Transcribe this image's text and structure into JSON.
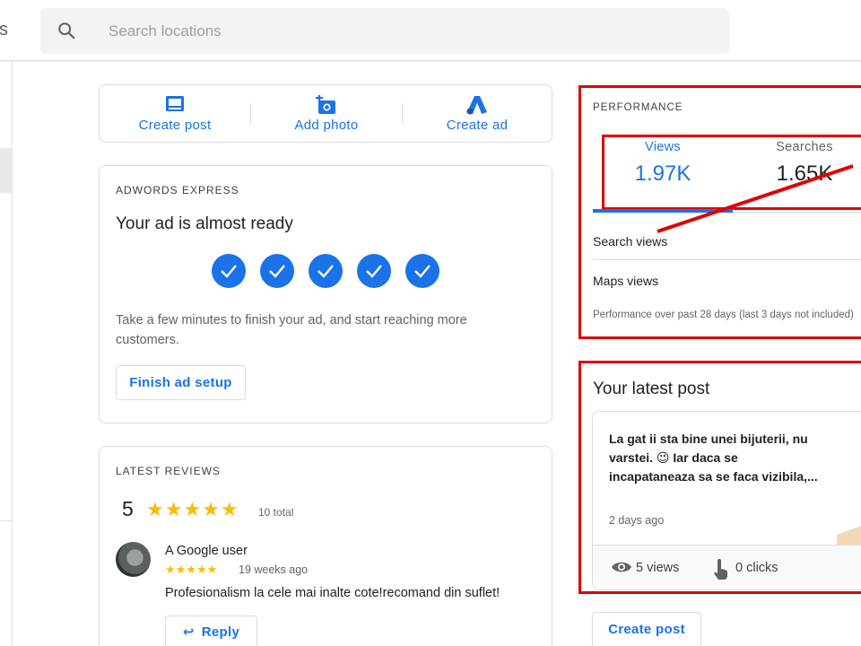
{
  "header": {
    "cut_title": "s",
    "search_placeholder": "Search locations"
  },
  "actions": [
    {
      "label": "Create post",
      "icon": "post-icon"
    },
    {
      "label": "Add photo",
      "icon": "add-photo-icon"
    },
    {
      "label": "Create ad",
      "icon": "google-ads-icon"
    }
  ],
  "adwords": {
    "overline": "ADWORDS EXPRESS",
    "title": "Your ad is almost ready",
    "steps_completed": 5,
    "description": "Take a few minutes to finish your ad, and start reaching more customers.",
    "button": "Finish ad setup"
  },
  "reviews": {
    "overline": "LATEST REVIEWS",
    "rating": "5",
    "stars": 5,
    "total": "10 total",
    "latest": {
      "author": "A Google user",
      "stars": 5,
      "when": "19 weeks ago",
      "text": "Profesionalism la cele mai inalte cote!recomand din suflet!",
      "reply_label": "Reply"
    }
  },
  "performance": {
    "overline": "PERFORMANCE",
    "tabs": [
      {
        "label": "Views",
        "value": "1.97K",
        "active": true
      },
      {
        "label": "Searches",
        "value": "1.65K",
        "active": false
      }
    ],
    "rows": [
      "Search views",
      "Maps views"
    ],
    "note": "Performance over past 28 days (last 3 days not included)"
  },
  "latest_post": {
    "title": "Your latest post",
    "text": "La gat ii sta bine unei bijuterii, nu varstei. 😉 Iar daca se incapataneaza sa se faca vizibila,...",
    "date": "2 days ago",
    "views": "5 views",
    "clicks": "0 clicks"
  },
  "bottom_button": "Create post",
  "colors": {
    "accent": "#1a73e8",
    "star": "#fbbc04",
    "annotation_red": "#e00000"
  }
}
